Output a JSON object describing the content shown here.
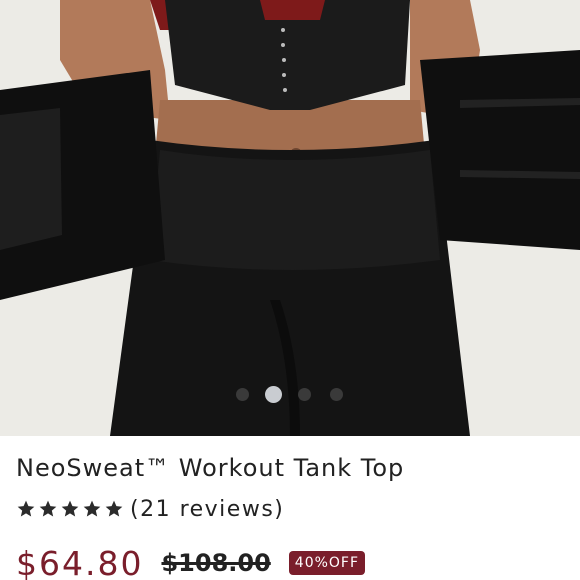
{
  "product": {
    "title": "NeoSweat™ Workout Tank Top",
    "rating": 5,
    "reviews_label": "(21 reviews)",
    "price": "$64.80",
    "original_price": "$108.00",
    "discount_badge": "40%OFF"
  },
  "carousel": {
    "slide_count": 4,
    "active_index": 1
  },
  "colors": {
    "price": "#7a1e2b",
    "badge_bg": "#7a1e2b",
    "text": "#222222",
    "dot_active": "#c9ccd1",
    "dot_inactive": "#3a3a3a"
  }
}
